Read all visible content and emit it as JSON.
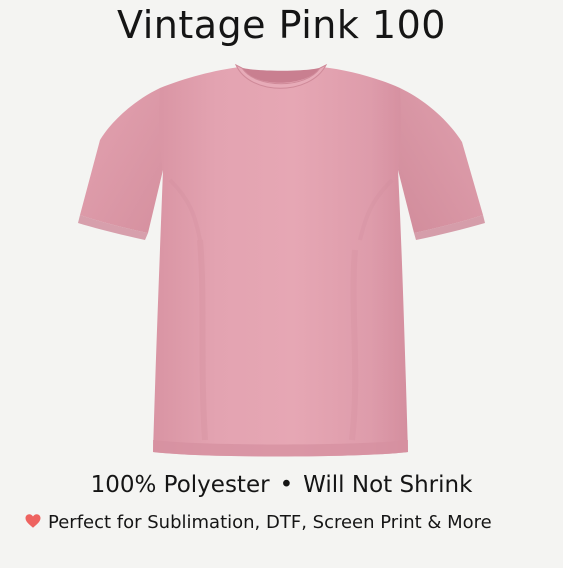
{
  "product": {
    "title": "Vintage Pink 100",
    "shirt_color": "#e2a0ae",
    "shirt_shadow": "#cf8c9b",
    "shirt_highlight": "#eab1bd"
  },
  "features": {
    "material": "100% Polyester",
    "separator": "•",
    "shrink": "Will Not Shrink"
  },
  "tagline": {
    "icon": "heart-icon",
    "text": "Perfect for Sublimation, DTF, Screen Print & More",
    "heart_color": "#ee6360"
  }
}
